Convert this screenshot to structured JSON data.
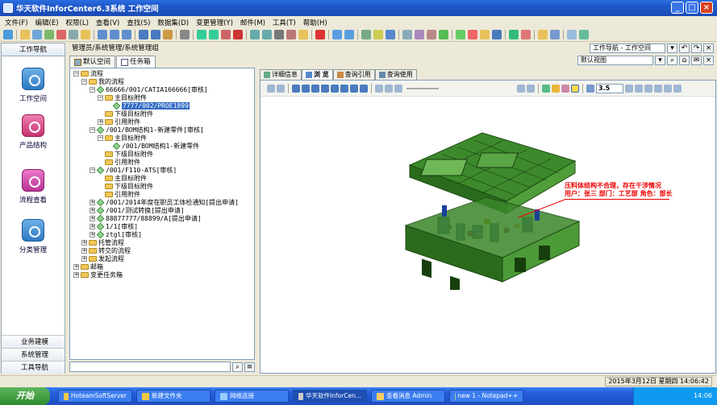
{
  "window": {
    "title": "华天软件InforCenter6.3系统 工作空间"
  },
  "menu": [
    "文件(F)",
    "编辑(E)",
    "权限(L)",
    "查看(V)",
    "查找(S)",
    "数据集(D)",
    "变更管理(Y)",
    "邮件(M)",
    "工具(T)",
    "帮助(H)"
  ],
  "leftnav": {
    "header": "工作导航",
    "items": [
      {
        "label": "工作空间",
        "icon": "home-icon"
      },
      {
        "label": "产品结构",
        "icon": "product-structure-icon"
      },
      {
        "label": "流程查看",
        "icon": "process-view-icon"
      },
      {
        "label": "分类管理",
        "icon": "category-icon"
      }
    ],
    "bottom": [
      "业务建模",
      "系统管理",
      "工具导航"
    ]
  },
  "breadcrumb": "管理员/系统管理/系统管理组",
  "right_controls": {
    "nav_label": "工作导航 - 工作空间",
    "view_label": "默认视图"
  },
  "tabs": [
    {
      "label": "默认空间"
    },
    {
      "label": "任务箱",
      "active": true
    }
  ],
  "tree": [
    {
      "text": "流程",
      "level": 0,
      "exp": "-"
    },
    {
      "text": "我的流程",
      "level": 1,
      "exp": "-"
    },
    {
      "text": "66666/001/CATIA166666[审核]",
      "level": 2,
      "exp": "-"
    },
    {
      "text": "主目标附件",
      "level": 3,
      "exp": "-"
    },
    {
      "text": "7777/002/PROE1899",
      "level": 4,
      "exp": "",
      "selected": true
    },
    {
      "text": "下级目标附件",
      "level": 3,
      "exp": ""
    },
    {
      "text": "引用附件",
      "level": 3,
      "exp": "+"
    },
    {
      "text": "/001/BOM结构1-新建零件[审核]",
      "level": 2,
      "exp": "-"
    },
    {
      "text": "主目标附件",
      "level": 3,
      "exp": "-"
    },
    {
      "text": "/001/BOM结构1-新建零件",
      "level": 4,
      "exp": ""
    },
    {
      "text": "下级目标附件",
      "level": 3,
      "exp": ""
    },
    {
      "text": "引用附件",
      "level": 3,
      "exp": ""
    },
    {
      "text": "/001/F110-ATS[审核]",
      "level": 2,
      "exp": "-"
    },
    {
      "text": "主目标附件",
      "level": 3,
      "exp": ""
    },
    {
      "text": "下级目标附件",
      "level": 3,
      "exp": ""
    },
    {
      "text": "引用附件",
      "level": 3,
      "exp": ""
    },
    {
      "text": "/001/2014年度在职员工体检通知[提出申请]",
      "level": 2,
      "exp": "+"
    },
    {
      "text": "/001/测试转换[提出申请]",
      "level": 2,
      "exp": "+"
    },
    {
      "text": "88877777/88899/A[提出申请]",
      "level": 2,
      "exp": "+"
    },
    {
      "text": "1/1[审核]",
      "level": 2,
      "exp": "+"
    },
    {
      "text": "ztgl[审核]",
      "level": 2,
      "exp": "+"
    },
    {
      "text": "托管流程",
      "level": 1,
      "exp": "+"
    },
    {
      "text": "转交的流程",
      "level": 1,
      "exp": "+"
    },
    {
      "text": "发起流程",
      "level": 1,
      "exp": "+"
    },
    {
      "text": "邮箱",
      "level": 0,
      "exp": "+"
    },
    {
      "text": "变更任务箱",
      "level": 0,
      "exp": "+"
    }
  ],
  "viewer": {
    "tabs": [
      {
        "label": "详细信息"
      },
      {
        "label": "浏 览",
        "active": true
      },
      {
        "label": "查询引用"
      },
      {
        "label": "查询使用"
      }
    ],
    "zoom": "3.5",
    "annotation_line1": "压料体结构不合理，存在干涉情况",
    "annotation_line2": "用户：张三   部门：工艺部  角色：部长"
  },
  "status": {
    "datetime": "2015年3月12日 星期四 14:06:42"
  },
  "taskbar": {
    "start": "开始",
    "tasks": [
      "HoteamSoftServer",
      "新建文件夹",
      "网络连接",
      "华天软件InforCen...",
      "查看消息  Admin",
      "new  1 - Notepad++"
    ],
    "clock": "14:06"
  }
}
